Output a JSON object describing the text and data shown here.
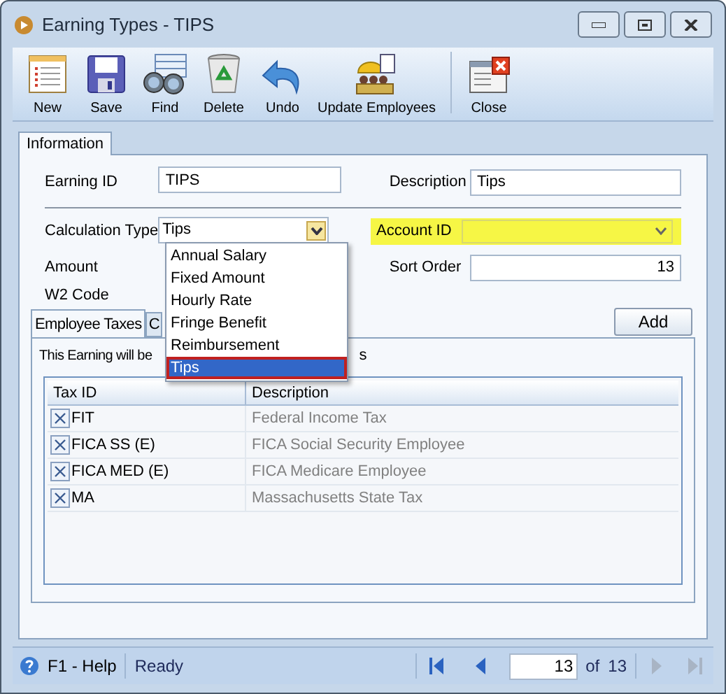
{
  "window": {
    "title": "Earning Types - TIPS"
  },
  "toolbar": [
    {
      "label": "New",
      "kind": "new"
    },
    {
      "label": "Save",
      "kind": "save"
    },
    {
      "label": "Find",
      "kind": "find"
    },
    {
      "label": "Delete",
      "kind": "delete"
    },
    {
      "label": "Undo",
      "kind": "undo"
    },
    {
      "label": "Update Employees",
      "kind": "employees"
    },
    {
      "label": "Close",
      "kind": "close",
      "separated": true
    }
  ],
  "tabs": [
    {
      "label": "Information",
      "selected": true
    }
  ],
  "form": {
    "earning_id": {
      "label": "Earning ID",
      "value": "TIPS"
    },
    "description": {
      "label": "Description",
      "value": "Tips"
    },
    "calculation_type": {
      "label": "Calculation Type",
      "value": "Tips",
      "open": true,
      "options": [
        {
          "label": "Annual Salary",
          "selected": false
        },
        {
          "label": "Fixed Amount",
          "selected": false
        },
        {
          "label": "Hourly Rate",
          "selected": false
        },
        {
          "label": "Fringe Benefit",
          "selected": false
        },
        {
          "label": "Reimbursement",
          "selected": false
        },
        {
          "label": "Tips",
          "selected": true
        }
      ]
    },
    "account_id": {
      "label": "Account ID",
      "highlighted": true
    },
    "amount": {
      "label": "Amount"
    },
    "sort_order": {
      "label": "Sort Order",
      "value": "13"
    },
    "w2_code": {
      "label": "W2 Code"
    }
  },
  "subtabs": [
    {
      "label": "Employee Taxes",
      "selected": true
    },
    {
      "label": "C",
      "selected": false
    }
  ],
  "add_button": "Add",
  "note_parts": [
    "This Earning will be",
    "s"
  ],
  "table": {
    "columns": [
      "Tax ID",
      "Description"
    ],
    "rows": [
      {
        "tax_id": "FIT",
        "description": "Federal Income Tax"
      },
      {
        "tax_id": "FICA SS (E)",
        "description": "FICA Social Security Employee"
      },
      {
        "tax_id": "FICA MED (E)",
        "description": "FICA Medicare Employee"
      },
      {
        "tax_id": "MA",
        "description": "Massachusetts State Tax"
      }
    ]
  },
  "status_bar": {
    "help": "F1 - Help",
    "status": "Ready",
    "page": "13",
    "of": "of",
    "total": "13"
  }
}
